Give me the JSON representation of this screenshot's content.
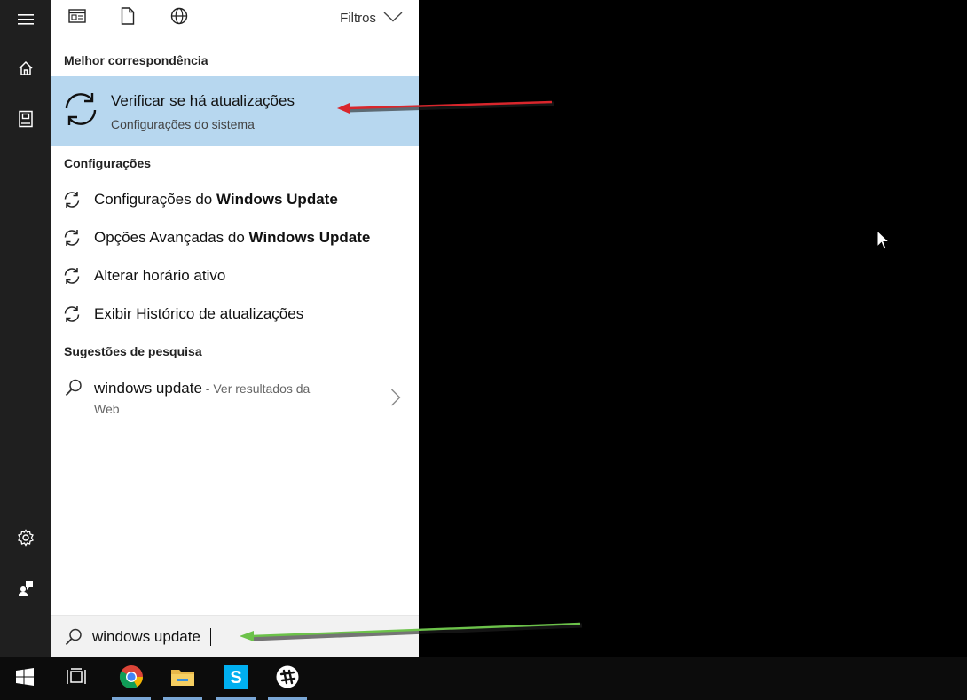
{
  "rail": {
    "icons": [
      "hamburger-icon",
      "home-icon",
      "notebook-icon",
      "settings-gear-icon",
      "feedback-icon"
    ]
  },
  "topbar": {
    "icons": [
      "apps-icon",
      "documents-icon",
      "web-globe-icon"
    ],
    "filters_label": "Filtros"
  },
  "best_match": {
    "section_label": "Melhor correspondência",
    "title": "Verificar se há atualizações",
    "subtitle": "Configurações do sistema",
    "icon": "sync-icon"
  },
  "settings": {
    "section_label": "Configurações",
    "items": [
      {
        "prefix": "Configurações do ",
        "bold": "Windows Update"
      },
      {
        "prefix": "Opções Avançadas do ",
        "bold": "Windows Update"
      },
      {
        "prefix": "Alterar horário ativo",
        "bold": ""
      },
      {
        "prefix": "Exibir Histórico de atualizações",
        "bold": ""
      }
    ]
  },
  "suggestions": {
    "section_label": "Sugestões de pesquisa",
    "query": "windows update",
    "web_suffix_1": " - Ver resultados da",
    "web_suffix_2": "Web"
  },
  "search": {
    "value": "windows update"
  },
  "taskbar": {
    "items": [
      "windows-start-icon",
      "task-view-icon",
      "chrome-icon",
      "file-explorer-icon",
      "skype-icon",
      "slack-icon"
    ]
  },
  "colors": {
    "highlight": "#b7d7ef",
    "rail": "#1f1f1f",
    "arrow_red": "#d9262c",
    "arrow_green": "#6cc24a"
  }
}
